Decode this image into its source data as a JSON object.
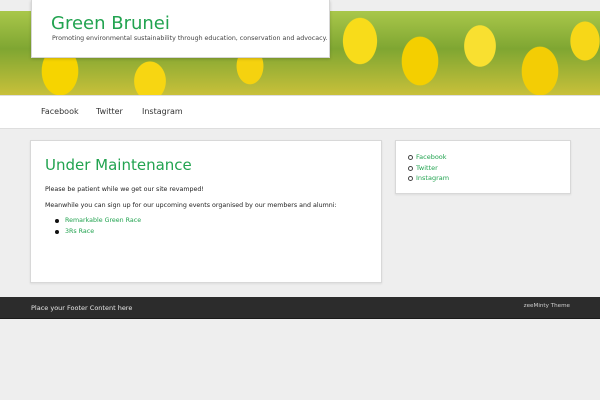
{
  "header": {
    "site_title": "Green Brunei",
    "tagline": "Promoting environmental sustainability through education, conservation and advocacy."
  },
  "nav": {
    "items": [
      {
        "label": "Facebook"
      },
      {
        "label": "Twitter"
      },
      {
        "label": "Instagram"
      }
    ]
  },
  "main": {
    "title": "Under Maintenance",
    "para1": "Please be patient while we get our site revamped!",
    "para2": "Meanwhile you can sign up for our upcoming events organised by our members and alumni:",
    "events": [
      {
        "label": "Remarkable Green Race"
      },
      {
        "label": "3Rs Race"
      }
    ]
  },
  "sidebar": {
    "links": [
      {
        "label": "Facebook"
      },
      {
        "label": "Twitter"
      },
      {
        "label": "Instagram"
      }
    ]
  },
  "footer": {
    "left_text": "Place your Footer Content here",
    "right_text": "zeeMinty Theme"
  },
  "colors": {
    "accent": "#22a350",
    "footer_bg": "#2c2c2c",
    "page_bg": "#eeeeee"
  }
}
